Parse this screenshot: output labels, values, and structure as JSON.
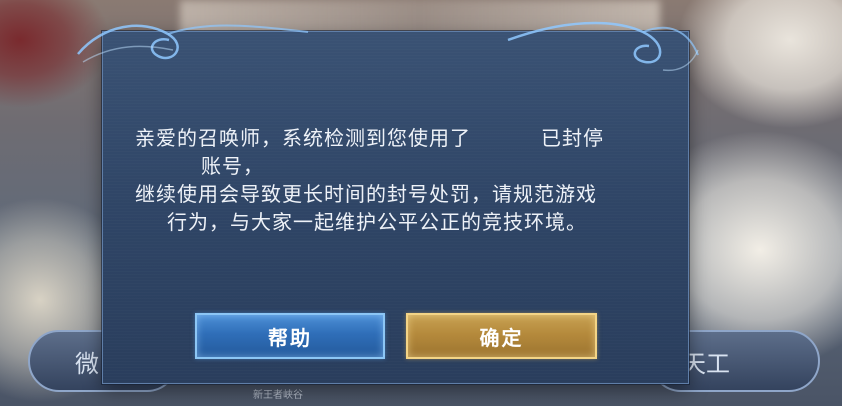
{
  "background": {
    "left_button_label": "微",
    "right_button_label": "天工",
    "caption": "新王者峡谷"
  },
  "dialog": {
    "message_line1_part1": "亲爱的召唤师，系统检测到您使用了",
    "message_line1_part2": "已封停",
    "message_line2": "账号，",
    "message_line3": "继续使用会导致更长时间的封号处罚，请规范游戏",
    "message_line4": "行为，与大家一起维护公平公正的竞技环境。",
    "help_button": "帮助",
    "confirm_button": "确定"
  },
  "colors": {
    "dialog_bg": "#2f4566",
    "help_button": "#2f6eb8",
    "confirm_button": "#b58a3c",
    "text": "#eef2f8"
  }
}
